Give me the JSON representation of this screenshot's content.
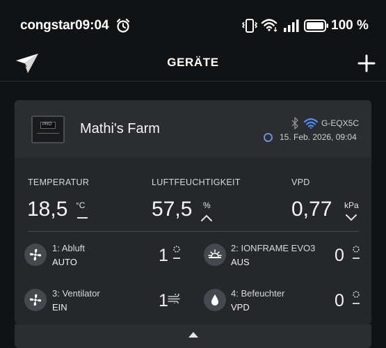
{
  "status_bar": {
    "carrier": "congstar",
    "time": "09:04",
    "battery": "100 %"
  },
  "header": {
    "title": "GERÄTE"
  },
  "device": {
    "name": "Mathi's Farm",
    "thumb_label": "PRO",
    "id": "G-EQX5C",
    "timestamp": "15. Feb. 2026, 09:04"
  },
  "metrics": {
    "temperature": {
      "label": "TEMPERATUR",
      "value": "18,5",
      "unit": "°C"
    },
    "humidity": {
      "label": "LUFTFEUCHTIGKEIT",
      "value": "57,5",
      "unit": "%"
    },
    "vpd": {
      "label": "VPD",
      "value": "0,77",
      "unit": "kPa"
    }
  },
  "ports": [
    {
      "name": "1: Abluft",
      "mode": "AUTO",
      "level": "1",
      "icon": "fan-icon"
    },
    {
      "name": "2: IONFRAME EVO3",
      "mode": "AUS",
      "level": "0",
      "icon": "grow-light-icon"
    },
    {
      "name": "3: Ventilator",
      "mode": "EIN",
      "level": "1",
      "icon": "fan-icon"
    },
    {
      "name": "4: Befeuchter",
      "mode": "VPD",
      "level": "0",
      "icon": "water-drop-icon"
    }
  ],
  "colors": {
    "background": "#111214",
    "card": "#25272b",
    "accent_blue": "#4f8ff7"
  }
}
